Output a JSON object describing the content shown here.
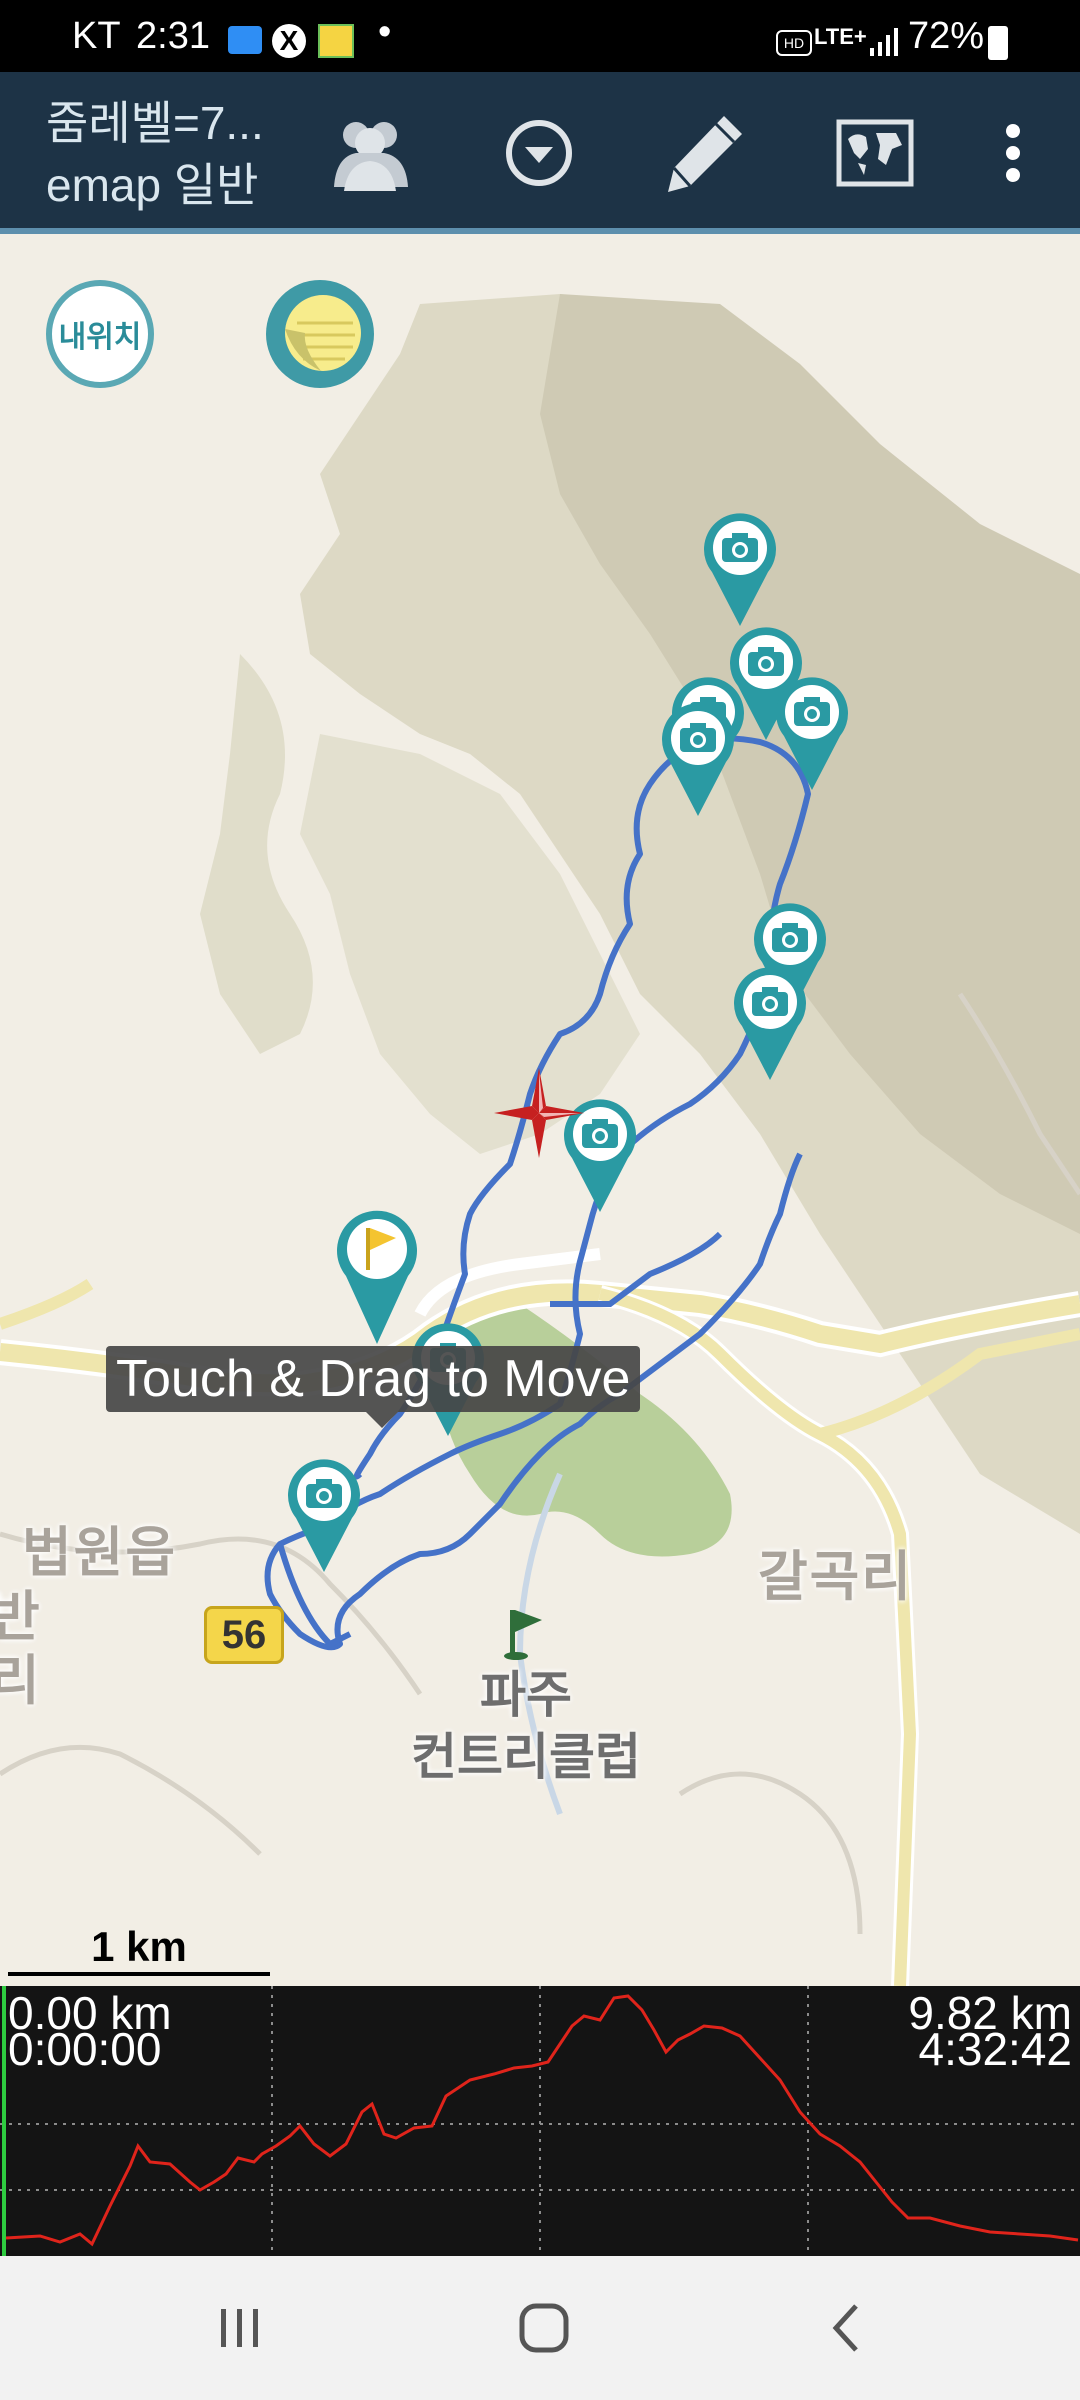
{
  "status_bar": {
    "carrier": "KT",
    "time": "2:31",
    "dot": "•",
    "battery": "72%"
  },
  "toolbar": {
    "title_line1": "줌레벨=7...",
    "title_line2": "emap 일반",
    "buttons": [
      "group-icon",
      "dropdown-icon",
      "pencil-icon",
      "world-map-icon",
      "more-vert-icon"
    ]
  },
  "map": {
    "my_location_label": "내위치",
    "tooltip": "Touch & Drag to Move",
    "place_labels": {
      "beobwon": "법원읍",
      "galgok": "갈곡리",
      "route_number": "56",
      "country_club_line1": "파주",
      "country_club_line2": "컨트리클럽",
      "left_edge_1": "반",
      "left_edge_2": "리"
    },
    "scale_label": "1 km",
    "colors": {
      "track": "#3f6fd1",
      "pin": "#2a9aa3",
      "start_flag": "#f4c430"
    }
  },
  "elevation": {
    "start_distance": "0.00 km",
    "start_time": "0:00:00",
    "end_distance": "9.82 km",
    "end_time": "4:32:42",
    "profile_color": "#e0241b"
  },
  "nav_bar": {
    "buttons": [
      "recent-apps-icon",
      "home-icon",
      "back-icon"
    ]
  }
}
